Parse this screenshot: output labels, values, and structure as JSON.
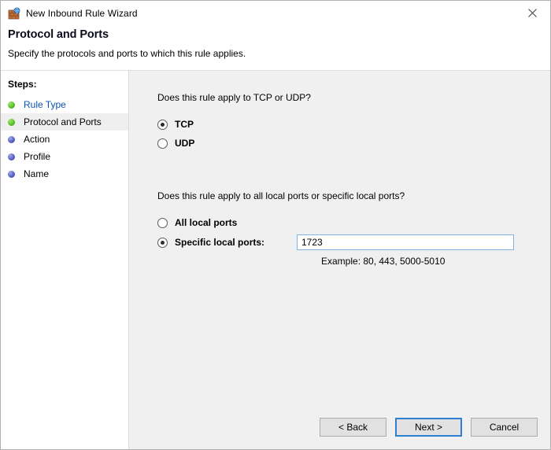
{
  "window": {
    "title": "New Inbound Rule Wizard",
    "icon": "firewall-globe-icon",
    "close_label": "✕"
  },
  "header": {
    "title": "Protocol and Ports",
    "subtitle": "Specify the protocols and ports to which this rule applies."
  },
  "sidebar": {
    "label": "Steps:",
    "items": [
      {
        "label": "Rule Type",
        "state": "link",
        "dot": "green"
      },
      {
        "label": "Protocol and Ports",
        "state": "current",
        "dot": "green"
      },
      {
        "label": "Action",
        "state": "upcoming",
        "dot": "blue"
      },
      {
        "label": "Profile",
        "state": "upcoming",
        "dot": "blue"
      },
      {
        "label": "Name",
        "state": "upcoming",
        "dot": "blue"
      }
    ]
  },
  "main": {
    "protocol_question": "Does this rule apply to TCP or UDP?",
    "protocol_options": [
      {
        "label": "TCP",
        "selected": true
      },
      {
        "label": "UDP",
        "selected": false
      }
    ],
    "ports_question": "Does this rule apply to all local ports or specific local ports?",
    "all_ports_label": "All local ports",
    "specific_ports_label": "Specific local ports:",
    "ports_value": "1723",
    "ports_placeholder": "",
    "example_text": "Example: 80, 443, 5000-5010"
  },
  "footer": {
    "back_label": "< Back",
    "next_label": "Next >",
    "cancel_label": "Cancel"
  },
  "colors": {
    "accent": "#2f7fd1",
    "link": "#0a52b5",
    "panel": "#f0f0f0",
    "input_border": "#7fb4e3",
    "dot_green": "#5cc12b",
    "dot_blue": "#5a62c4"
  }
}
